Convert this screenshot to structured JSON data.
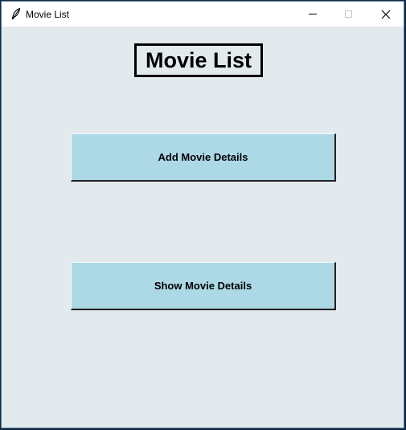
{
  "window": {
    "title": "Movie List",
    "app_icon": "feather-icon"
  },
  "titlebar_controls": {
    "minimize_icon": "minimize-icon",
    "maximize_icon": "maximize-icon",
    "close_icon": "close-icon"
  },
  "main": {
    "heading": "Movie List",
    "add_button_label": "Add Movie Details",
    "show_button_label": "Show Movie Details"
  },
  "colors": {
    "background": "#e3eaee",
    "button": "#add8e6",
    "heading_border": "#000000"
  }
}
